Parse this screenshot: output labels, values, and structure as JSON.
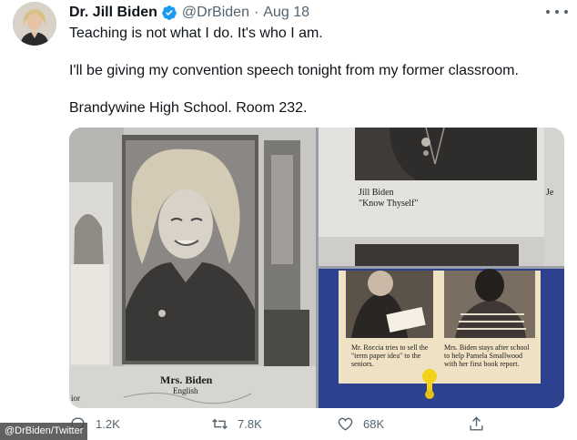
{
  "tweet": {
    "author_name": "Dr. Jill Biden",
    "handle": "@DrBiden",
    "separator": "·",
    "date": "Aug 18",
    "lines": [
      "Teaching is not what I do. It's who I am.",
      "I'll be giving my convention speech tonight from my former classroom.",
      "Brandywine High School. Room 232."
    ]
  },
  "media": {
    "yearbook_left": {
      "caption_name": "Mrs. Biden",
      "caption_subject": "English",
      "edge_fragment": "ior"
    },
    "yearbook_top_right": {
      "name": "Jill Biden",
      "quote": "\"Know Thyself\"",
      "edge_fragment": "Je"
    },
    "clipping": {
      "caption_left": "Mr. Roccia tries to sell the \"term paper idea\" to the seniors.",
      "caption_right": "Mrs. Biden stays after school to help Pamela Smallwood with her first book report."
    }
  },
  "actions": {
    "replies": "1.2K",
    "retweets": "7.8K",
    "likes": "68K"
  },
  "credit": "@DrBiden/Twitter",
  "colors": {
    "verified": "#1d9bf0",
    "secondary_text": "#536471",
    "clipping_paper": "#f0e3c6",
    "board": "#2c3f8e"
  }
}
